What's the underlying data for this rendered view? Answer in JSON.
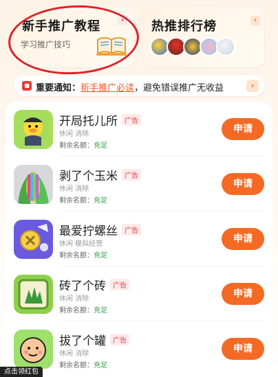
{
  "cards": {
    "left": {
      "title": "新手推广教程",
      "subtitle": "学习推广技巧",
      "chevron": "›"
    },
    "right": {
      "title": "热推排行榜",
      "chevron": "›"
    }
  },
  "notice": {
    "icon": "notice-icon",
    "label": "重要通知：",
    "link": "新手推广必读",
    "text": "，避免错误推广无收益",
    "chevron": "›"
  },
  "games": [
    {
      "name": "开局托儿所",
      "ad": "广告",
      "tags": "休闲 消除",
      "quota_label": "剩余名额：",
      "quota_value": "充足",
      "button": "申请",
      "icon": "duck-icon"
    },
    {
      "name": "剥了个玉米",
      "ad": "广告",
      "tags": "休闲 消除",
      "quota_label": "剩余名额：",
      "quota_value": "充足",
      "button": "申请",
      "icon": "corn-icon"
    },
    {
      "name": "最爱拧螺丝",
      "ad": "广告",
      "tags": "休闲 模拟经营",
      "quota_label": "剩余名额：",
      "quota_value": "充足",
      "button": "申请",
      "icon": "screw-icon"
    },
    {
      "name": "砖了个砖",
      "ad": "广告",
      "tags": "休闲 消除",
      "quota_label": "剩余名额：",
      "quota_value": "充足",
      "button": "申请",
      "icon": "tile-icon"
    },
    {
      "name": "拔了个罐",
      "ad": "广告",
      "tags": "休闲 消除",
      "quota_label": "剩余名额：",
      "quota_value": "充足",
      "button": "申请",
      "icon": "face-icon"
    }
  ],
  "toast": "点击领红包",
  "colors": {
    "accent": "#f46a24",
    "quota": "#2e9e3e",
    "ad": "#e84040",
    "circle": "#e0202a"
  }
}
